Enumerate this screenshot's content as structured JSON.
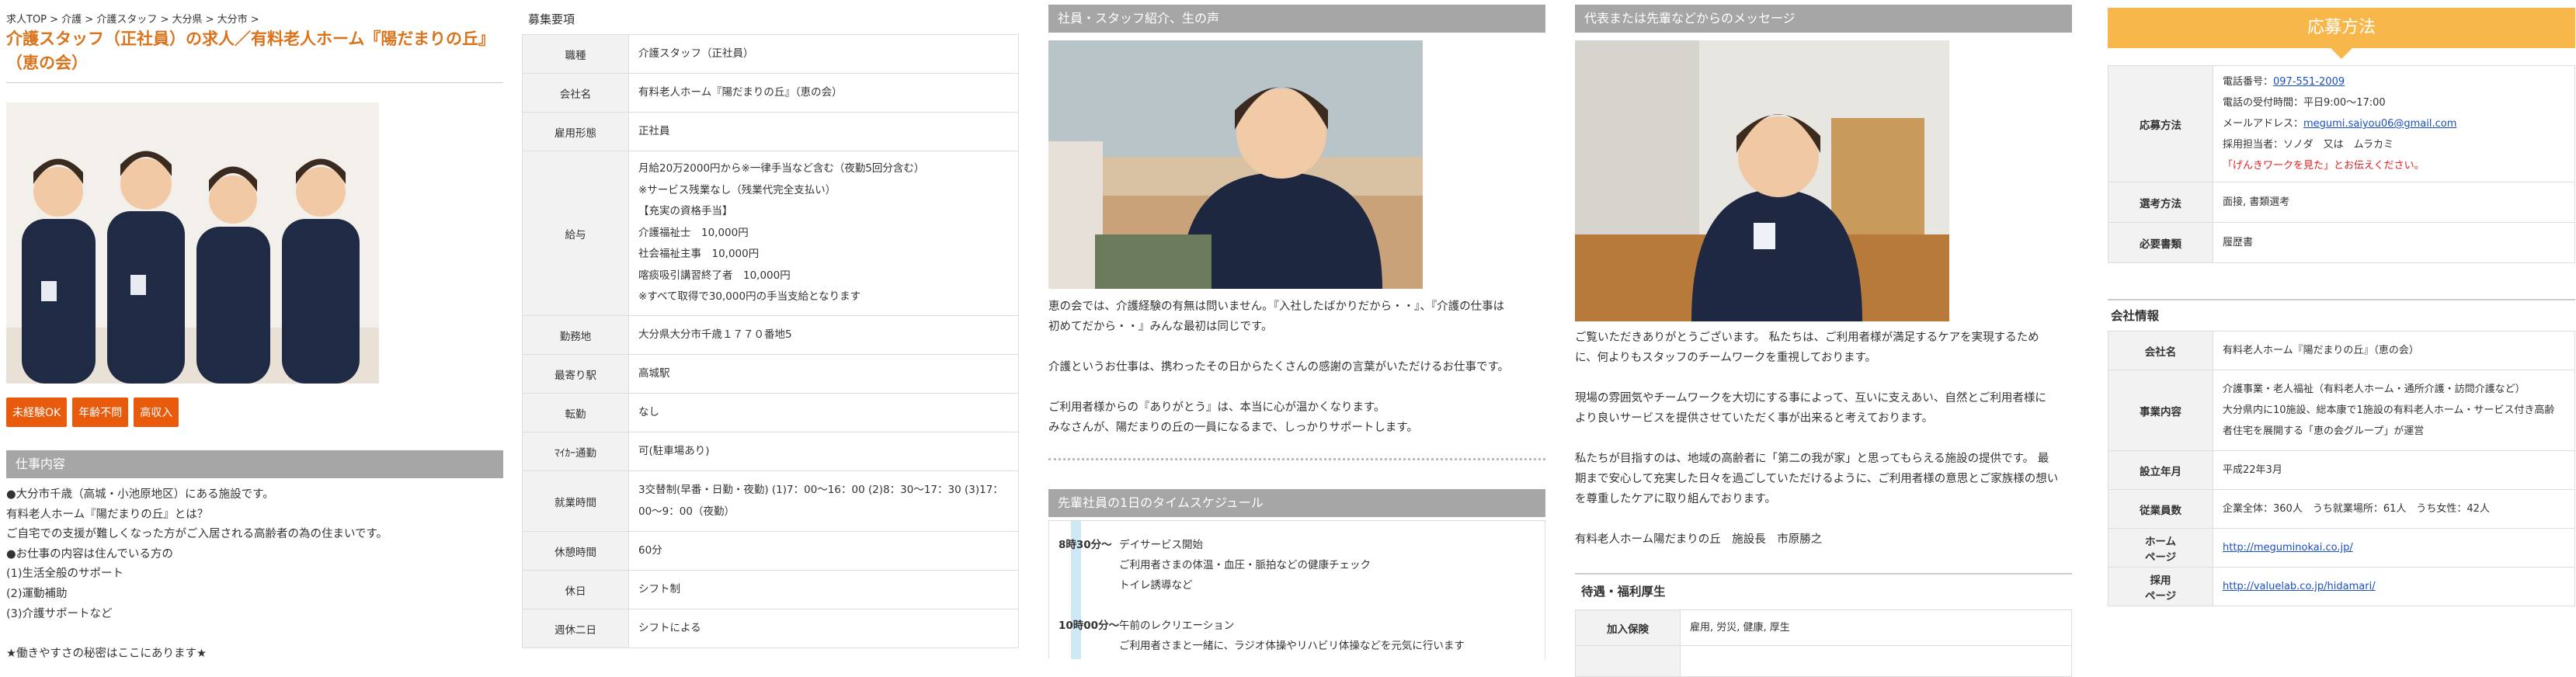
{
  "breadcrumb": "求人TOP > 介護 > 介護スタッフ > 大分県 > 大分市 >",
  "page_title": "介護スタッフ（正社員）の求人／有料老人ホーム『陽だまりの丘』（恵の会）",
  "tags": [
    "未経験OK",
    "年齢不問",
    "高収入"
  ],
  "job": {
    "heading": "仕事内容",
    "lines": [
      "●大分市千歳（高城・小池原地区）にある施設です。",
      "有料老人ホーム『陽だまりの丘』とは？",
      "ご自宅での支援が難しくなった方がご入居される高齢者の為の住まいです。",
      "●お仕事の内容は住んでいる方の",
      "(1)生活全般のサポート",
      "(2)運動補助",
      "(3)介護サポートなど",
      "",
      "★働きやすさの秘密はここにあります★"
    ]
  },
  "requirements": {
    "heading": "募集要項",
    "rows": [
      {
        "label": "職種",
        "lines": [
          "介護スタッフ（正社員）"
        ]
      },
      {
        "label": "会社名",
        "lines": [
          "有料老人ホーム『陽だまりの丘』（恵の会）"
        ]
      },
      {
        "label": "雇用形態",
        "lines": [
          "正社員"
        ]
      },
      {
        "label": "給与",
        "lines": [
          "月給20万2000円から※一律手当など含む（夜勤5回分含む）",
          "※サービス残業なし（残業代完全支払い）",
          "【充実の資格手当】",
          "介護福祉士　10,000円",
          "社会福祉主事　10,000円",
          "喀痰吸引講習終了者　10,000円",
          "※すべて取得で30,000円の手当支給となります"
        ]
      },
      {
        "label": "勤務地",
        "lines": [
          "大分県大分市千歳１７７０番地5"
        ]
      },
      {
        "label": "最寄り駅",
        "lines": [
          "高城駅"
        ]
      },
      {
        "label": "転勤",
        "lines": [
          "なし"
        ]
      },
      {
        "label": "ﾏｲｶｰ通勤",
        "lines": [
          "可(駐車場あり)"
        ]
      },
      {
        "label": "就業時間",
        "lines": [
          "3交替制(早番・日勤・夜勤) (1)7：00～16：00 (2)8：30～17：30 (3)17：",
          "00～9：00（夜勤）"
        ]
      },
      {
        "label": "休憩時間",
        "lines": [
          "60分"
        ]
      },
      {
        "label": "休日",
        "lines": [
          "シフト制"
        ]
      },
      {
        "label": "週休二日",
        "lines": [
          "シフトによる"
        ]
      }
    ]
  },
  "staff_voice": {
    "heading": "社員・スタッフ紹介、生の声",
    "lines": [
      "恵の会では、介護経験の有無は問いません。『入社したばかりだから・・』、『介護の仕事は",
      "初めてだから・・』みんな最初は同じです。",
      "",
      "介護というお仕事は、携わったその日からたくさんの感謝の言葉がいただけるお仕事です。",
      "",
      "ご利用者様からの『ありがとう』は、本当に心が温かくなります。",
      "みなさんが、陽だまりの丘の一員になるまで、しっかりサポートします。"
    ]
  },
  "schedule": {
    "heading": "先輩社員の1日のタイムスケジュール",
    "items": [
      {
        "time": "8時30分～",
        "lines": [
          "デイサービス開始",
          "ご利用者さまの体温・血圧・脈拍などの健康チェック",
          "トイレ誘導など"
        ]
      },
      {
        "time": "10時00分～",
        "lines": [
          "午前のレクリエーション",
          "ご利用者さまと一緒に、ラジオ体操やリハビリ体操などを元気に行います"
        ]
      }
    ]
  },
  "message": {
    "heading": "代表または先輩などからのメッセージ",
    "lines": [
      "ご覧いただきありがとうございます。 私たちは、ご利用者様が満足するケアを実現するため",
      "に、何よりもスタッフのチームワークを重視しております。",
      "",
      "現場の雰囲気やチームワークを大切にする事によって、互いに支えあい、自然とご利用者様に",
      "より良いサービスを提供させていただく事が出来ると考えております。",
      "",
      "私たちが目指すのは、地域の高齢者に「第二の我が家」と思ってもらえる施設の提供です。 最",
      "期まで安心して充実した日々を過ごしていただけるように、ご利用者様の意思とご家族様の想い",
      "を尊重したケアに取り組んでおります。",
      "",
      "有料老人ホーム陽だまりの丘　施設長　市原勝之"
    ]
  },
  "benefits": {
    "heading": "待遇・福利厚生",
    "rows": [
      {
        "label": "加入保険",
        "value": "雇用, 労災, 健康, 厚生"
      }
    ]
  },
  "apply": {
    "heading": "応募方法",
    "method_label": "応募方法",
    "phone_prefix": "電話番号：",
    "phone": "097-551-2009",
    "hours": "電話の受付時間：平日9:00～17:00",
    "email_prefix": "メールアドレス：",
    "email": "megumi.saiyou06@gmail.com",
    "contact": "採用担当者：ソノダ　又は　ムラカミ",
    "note": "「げんきワークを見た」とお伝えください。",
    "selection_label": "選考方法",
    "selection": "面接, 書類選考",
    "docs_label": "必要書類",
    "docs": "履歴書"
  },
  "company": {
    "heading": "会社情報",
    "name_label": "会社名",
    "name": "有料老人ホーム『陽だまりの丘』（恵の会）",
    "business_label": "事業内容",
    "business_lines": [
      "介護事業・老人福祉（有料老人ホーム・通所介護・訪問介護など）",
      "大分県内に10施設、総本康で1施設の有料老人ホーム・サービス付き高齢",
      "者住宅を展開する「恵の会グループ」が運営"
    ],
    "founded_label": "設立年月",
    "founded": "平成22年3月",
    "employees_label": "従業員数",
    "employees": "企業全体：360人　うち就業場所：61人　うち女性：42人",
    "homepage_label": "ホーム\nページ",
    "homepage": "http://meguminokai.co.jp/",
    "recruit_label": "採用\nページ",
    "recruit": "http://valuelab.co.jp/hidamari/"
  },
  "colors": {
    "accent": "#e85a0c",
    "title": "#d9741c",
    "section_bar": "#a6a6a6",
    "apply_header": "#f7b74a",
    "link": "#1a4fc0"
  }
}
